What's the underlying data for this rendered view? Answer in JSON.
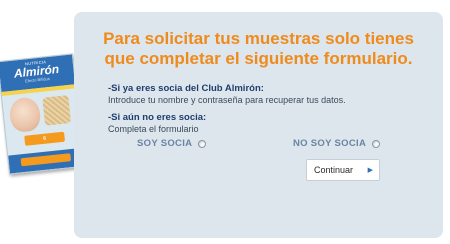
{
  "product": {
    "brand_top": "NUTRICIA",
    "brand": "Almirón",
    "variant": "Efecto Bífidus",
    "badge": "6"
  },
  "panel": {
    "headline_line1": "Para solicitar tus muestras solo tienes",
    "headline_line2": "que completar el siguiente formulario.",
    "member_title": "-Si ya eres socia del Club Almirón:",
    "member_text": "Introduce tu nombre y contraseña para recuperar tus datos.",
    "nonmember_title": "-Si aún no eres socia:",
    "nonmember_text": "Completa el formulario",
    "radio_soy_socia": "SOY SOCIA",
    "radio_no_soy_socia": "NO SOY SOCIA",
    "continue_button": "Continuar"
  },
  "colors": {
    "headline": "#ef8b1c",
    "panel_bg": "#dde6ec",
    "title_blue": "#1f3e6e"
  }
}
